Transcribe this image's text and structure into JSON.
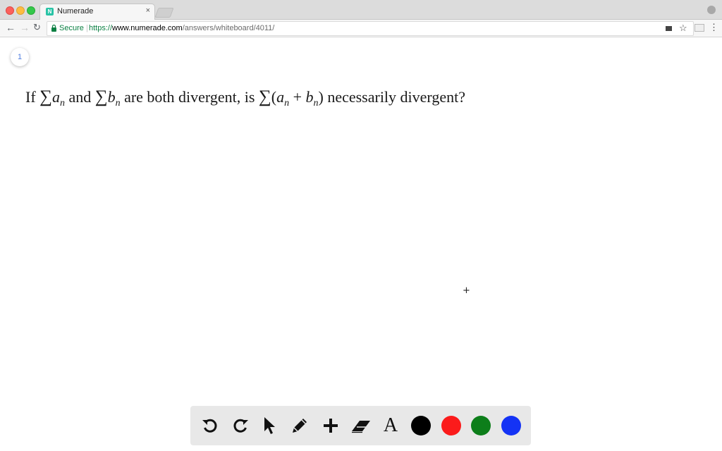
{
  "browser": {
    "tab_title": "Numerade",
    "tab_favicon_letter": "N",
    "tab_close": "×",
    "secure_label": "Secure",
    "url_scheme": "https://",
    "url_host": "www.numerade.com",
    "url_path": "/answers/whiteboard/4011/"
  },
  "whiteboard": {
    "page_number": "1",
    "question": {
      "if": "If",
      "sigma": "∑",
      "a": "a",
      "n": "n",
      "and": "and",
      "b": "b",
      "are_both": "are both divergent, is",
      "open_paren": "(",
      "plus": "+",
      "close_paren": ")",
      "tail": "necessarily divergent?"
    }
  },
  "toolbar": {
    "tools": [
      "undo-icon",
      "redo-icon",
      "pointer-icon",
      "pencil-icon",
      "add-icon",
      "eraser-icon",
      "text-icon"
    ],
    "text_tool_glyph": "A",
    "colors": {
      "black": "#000000",
      "red": "#fb1b1b",
      "green": "#0d7e1a",
      "blue": "#1433f5"
    }
  }
}
